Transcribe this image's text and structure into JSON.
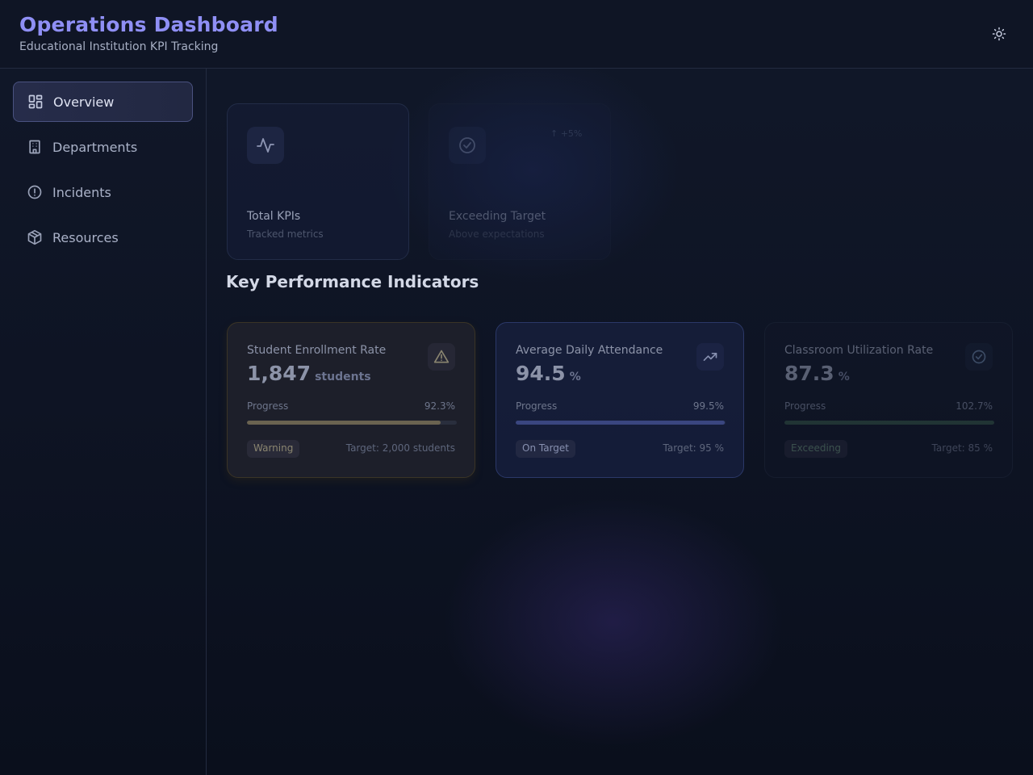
{
  "app": {
    "title": "Operations Dashboard",
    "subtitle": "Educational Institution KPI Tracking",
    "theme_toggle_icon": "sun-icon"
  },
  "sidebar": {
    "items": [
      {
        "label": "Overview",
        "icon": "grid-icon",
        "active": true
      },
      {
        "label": "Departments",
        "icon": "building-icon",
        "active": false
      },
      {
        "label": "Incidents",
        "icon": "alert-circle-icon",
        "active": false
      },
      {
        "label": "Resources",
        "icon": "package-icon",
        "active": false
      }
    ]
  },
  "stats": [
    {
      "label": "Total KPIs",
      "sub": "Tracked metrics",
      "icon": "activity-icon",
      "trend": ""
    },
    {
      "label": "Exceeding Target",
      "sub": "Above expectations",
      "icon": "check-circle-icon",
      "trend": "↑ +5%"
    }
  ],
  "section": {
    "title": "Key Performance Indicators"
  },
  "kpis": [
    {
      "name": "Student Enrollment Rate",
      "value": "1,847",
      "unit": "students",
      "progress_label": "Progress",
      "progress": "92.3%",
      "progress_fraction": 0.923,
      "status": "Warning",
      "status_color": "#8a8570",
      "target": "Target: 2,000 students",
      "icon": "warning-triangle-icon"
    },
    {
      "name": "Average Daily Attendance",
      "value": "94.5",
      "unit": "%",
      "progress_label": "Progress",
      "progress": "99.5%",
      "progress_fraction": 0.995,
      "status": "On Target",
      "status_color": "#8790b0",
      "target": "Target: 95 %",
      "icon": "trending-up-icon"
    },
    {
      "name": "Classroom Utilization Rate",
      "value": "87.3",
      "unit": "%",
      "progress_label": "Progress",
      "progress": "102.7%",
      "progress_fraction": 1.0,
      "status": "Exceeding",
      "status_color": "#5a7a6a",
      "target": "Target: 85 %",
      "icon": "check-circle-icon"
    }
  ],
  "colors": {
    "accent": "#8f8ff5",
    "warning_bar": "#6a6350",
    "ontarget_bar": "#3a4680",
    "exceeding_bar": "#2e4a40"
  }
}
